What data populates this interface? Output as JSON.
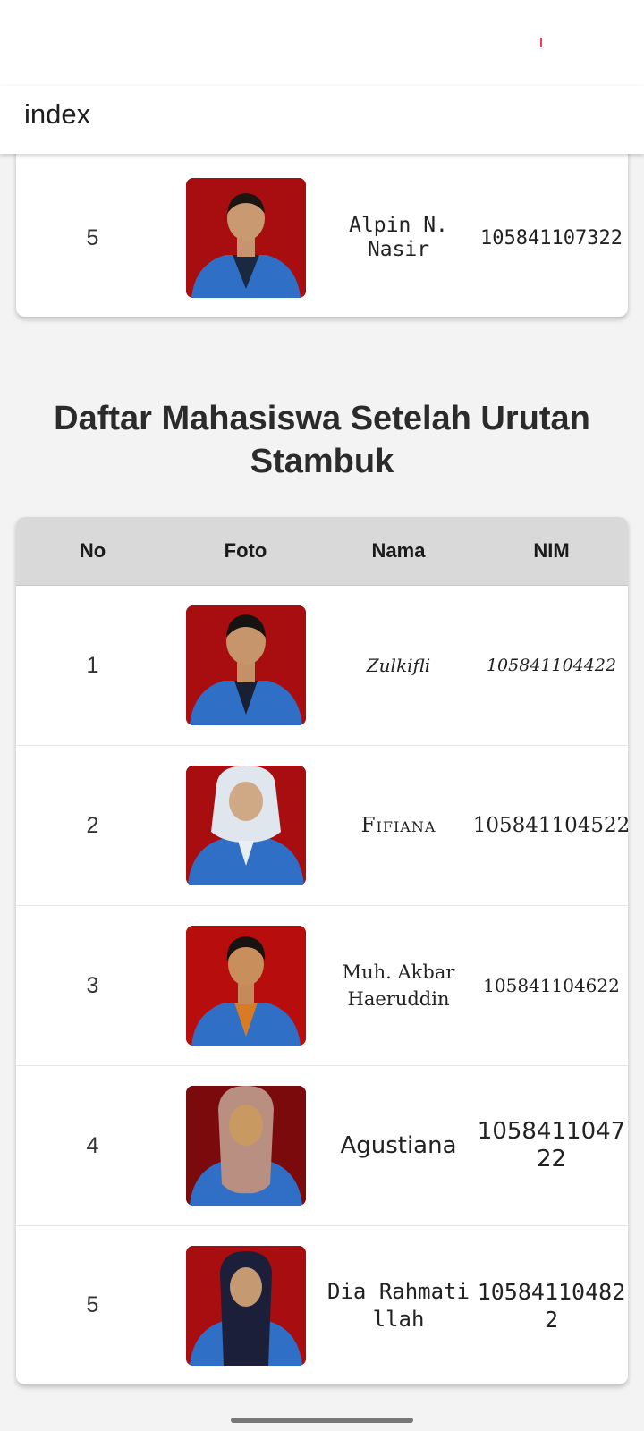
{
  "app": {
    "title": "index"
  },
  "top_card": {
    "no": "5",
    "nama": "Alpin N. Nasir",
    "nim": "105841107322"
  },
  "section_title": "Daftar Mahasiswa Setelah Urutan Stambuk",
  "table": {
    "headers": {
      "no": "No",
      "foto": "Foto",
      "nama": "Nama",
      "nim": "NIM"
    },
    "rows": [
      {
        "no": "1",
        "nama": "Zulkifli",
        "nim": "105841104422"
      },
      {
        "no": "2",
        "nama": "Fifiana",
        "nim": "105841104522"
      },
      {
        "no": "3",
        "nama": "Muh. Akbar Haeruddin",
        "nim": "105841104622"
      },
      {
        "no": "4",
        "nama": "Agustiana",
        "nim": "105841104722"
      },
      {
        "no": "5",
        "nama": "Dia Rahmatillah",
        "nim": "105841104822"
      }
    ]
  },
  "colors": {
    "photo_background": "#a80d10",
    "jacket": "#2f6fc6",
    "header_row": "#d9d9d9"
  }
}
